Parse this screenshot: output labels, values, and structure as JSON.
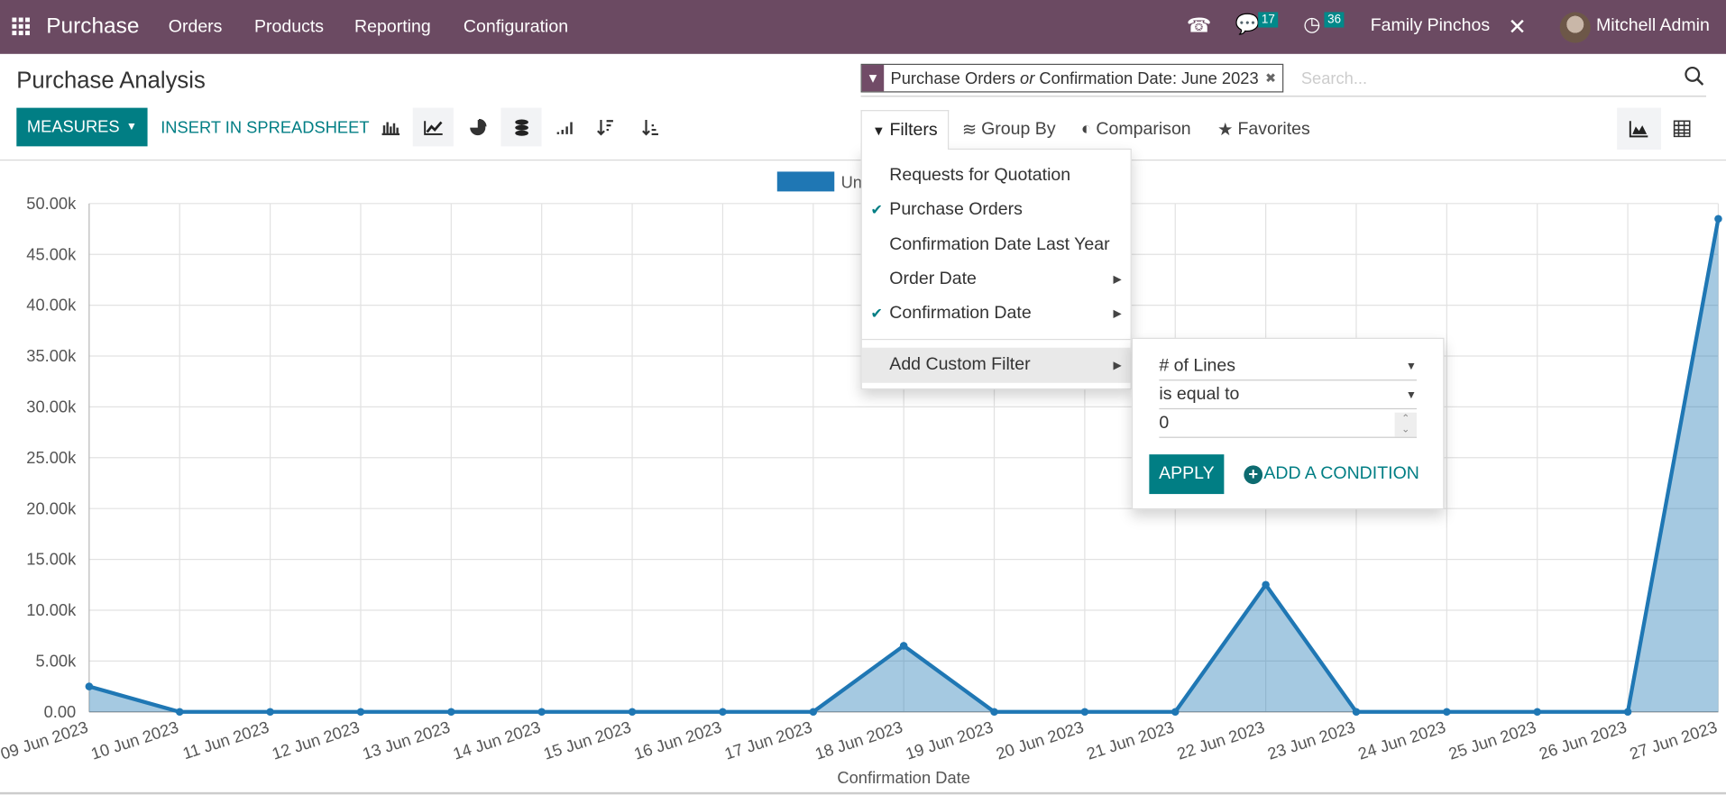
{
  "navbar": {
    "app": "Purchase",
    "menu": [
      "Orders",
      "Products",
      "Reporting",
      "Configuration"
    ],
    "messages_count": "17",
    "activities_count": "36",
    "company": "Family Pinchos",
    "user": "Mitchell Admin",
    "color": "#6b4a62"
  },
  "page": {
    "title": "Purchase Analysis"
  },
  "toolbar": {
    "measures": "MEASURES",
    "insert": "INSERT IN SPREADSHEET",
    "icons": [
      "bar-chart-icon",
      "line-chart-icon",
      "pie-chart-icon",
      "stacked-icon",
      "cumulative-icon",
      "sort-descending-icon",
      "sort-ascending-icon"
    ],
    "active": [
      "line-chart-icon",
      "stacked-icon"
    ]
  },
  "search": {
    "facet_a": "Purchase Orders",
    "facet_or": "or",
    "facet_b": "Confirmation Date: June 2023",
    "placeholder": "Search..."
  },
  "searchpanel": {
    "filters": "Filters",
    "groupby": "Group By",
    "comparison": "Comparison",
    "favorites": "Favorites"
  },
  "filters_menu": {
    "items": [
      {
        "label": "Requests for Quotation",
        "checked": false
      },
      {
        "label": "Purchase Orders",
        "checked": true
      },
      {
        "label": "Confirmation Date Last Year",
        "checked": false
      },
      {
        "label": "Order Date",
        "checked": false,
        "submenu": true
      },
      {
        "label": "Confirmation Date",
        "checked": true,
        "submenu": true
      }
    ],
    "custom": "Add Custom Filter"
  },
  "custom_filter": {
    "field": "# of Lines",
    "operator": "is equal to",
    "value": "0",
    "apply": "APPLY",
    "add_condition": "ADD A CONDITION"
  },
  "chart_data": {
    "type": "area",
    "legend": [
      "Untaxed Total"
    ],
    "legend_placement": "top",
    "color": "#1f77b4",
    "xlabel": "Confirmation Date",
    "ylabel": "",
    "ylim": [
      0,
      50000
    ],
    "yticks": [
      "0.00",
      "5.00k",
      "10.00k",
      "15.00k",
      "20.00k",
      "25.00k",
      "30.00k",
      "35.00k",
      "40.00k",
      "45.00k",
      "50.00k"
    ],
    "grid": true,
    "categories": [
      "09 Jun 2023",
      "10 Jun 2023",
      "11 Jun 2023",
      "12 Jun 2023",
      "13 Jun 2023",
      "14 Jun 2023",
      "15 Jun 2023",
      "16 Jun 2023",
      "17 Jun 2023",
      "18 Jun 2023",
      "19 Jun 2023",
      "20 Jun 2023",
      "21 Jun 2023",
      "22 Jun 2023",
      "23 Jun 2023",
      "24 Jun 2023",
      "25 Jun 2023",
      "26 Jun 2023",
      "27 Jun 2023"
    ],
    "values": [
      2500,
      0,
      0,
      0,
      0,
      0,
      0,
      0,
      0,
      6500,
      0,
      0,
      0,
      12500,
      0,
      0,
      0,
      0,
      48500
    ]
  }
}
